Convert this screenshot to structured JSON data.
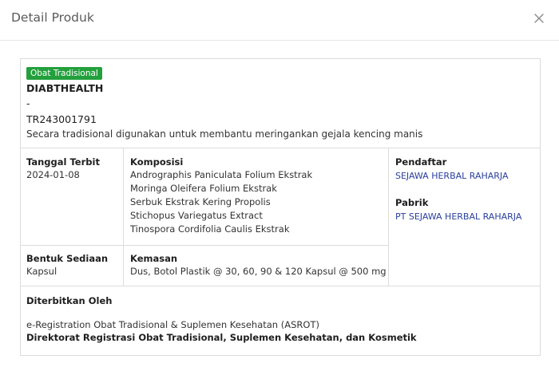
{
  "modal": {
    "title": "Detail Produk"
  },
  "product": {
    "badge": "Obat Tradisional",
    "name": "DIABTHEALTH",
    "dash": "-",
    "reg_no": "TR243001791",
    "description": "Secara tradisional digunakan untuk membantu meringankan gejala kencing manis"
  },
  "details": {
    "tanggal_terbit_label": "Tanggal Terbit",
    "tanggal_terbit_value": "2024-01-08",
    "komposisi_label": "Komposisi",
    "komposisi_items": [
      "Andrographis Paniculata Folium Ekstrak",
      "Moringa Oleifera Folium Ekstrak",
      "Serbuk Ekstrak Kering Propolis",
      "Stichopus Variegatus Extract",
      "Tinospora Cordifolia Caulis Ekstrak"
    ],
    "pendaftar_label": "Pendaftar",
    "pendaftar_value": "SEJAWA HERBAL RAHARJA",
    "pabrik_label": "Pabrik",
    "pabrik_value": "PT SEJAWA HERBAL RAHARJA",
    "bentuk_label": "Bentuk Sediaan",
    "bentuk_value": "Kapsul",
    "kemasan_label": "Kemasan",
    "kemasan_value": "Dus, Botol Plastik @ 30, 60, 90 & 120 Kapsul @ 500 mg",
    "diterbitkan_label": "Diterbitkan Oleh",
    "diterbitkan_line1": "e-Registration Obat Tradisional & Suplemen Kesehatan (ASROT)",
    "diterbitkan_line2": "Direktorat Registrasi Obat Tradisional, Suplemen Kesehatan, dan Kosmetik"
  },
  "colors": {
    "badge_bg": "#23a03c",
    "link": "#2a3f9c"
  }
}
